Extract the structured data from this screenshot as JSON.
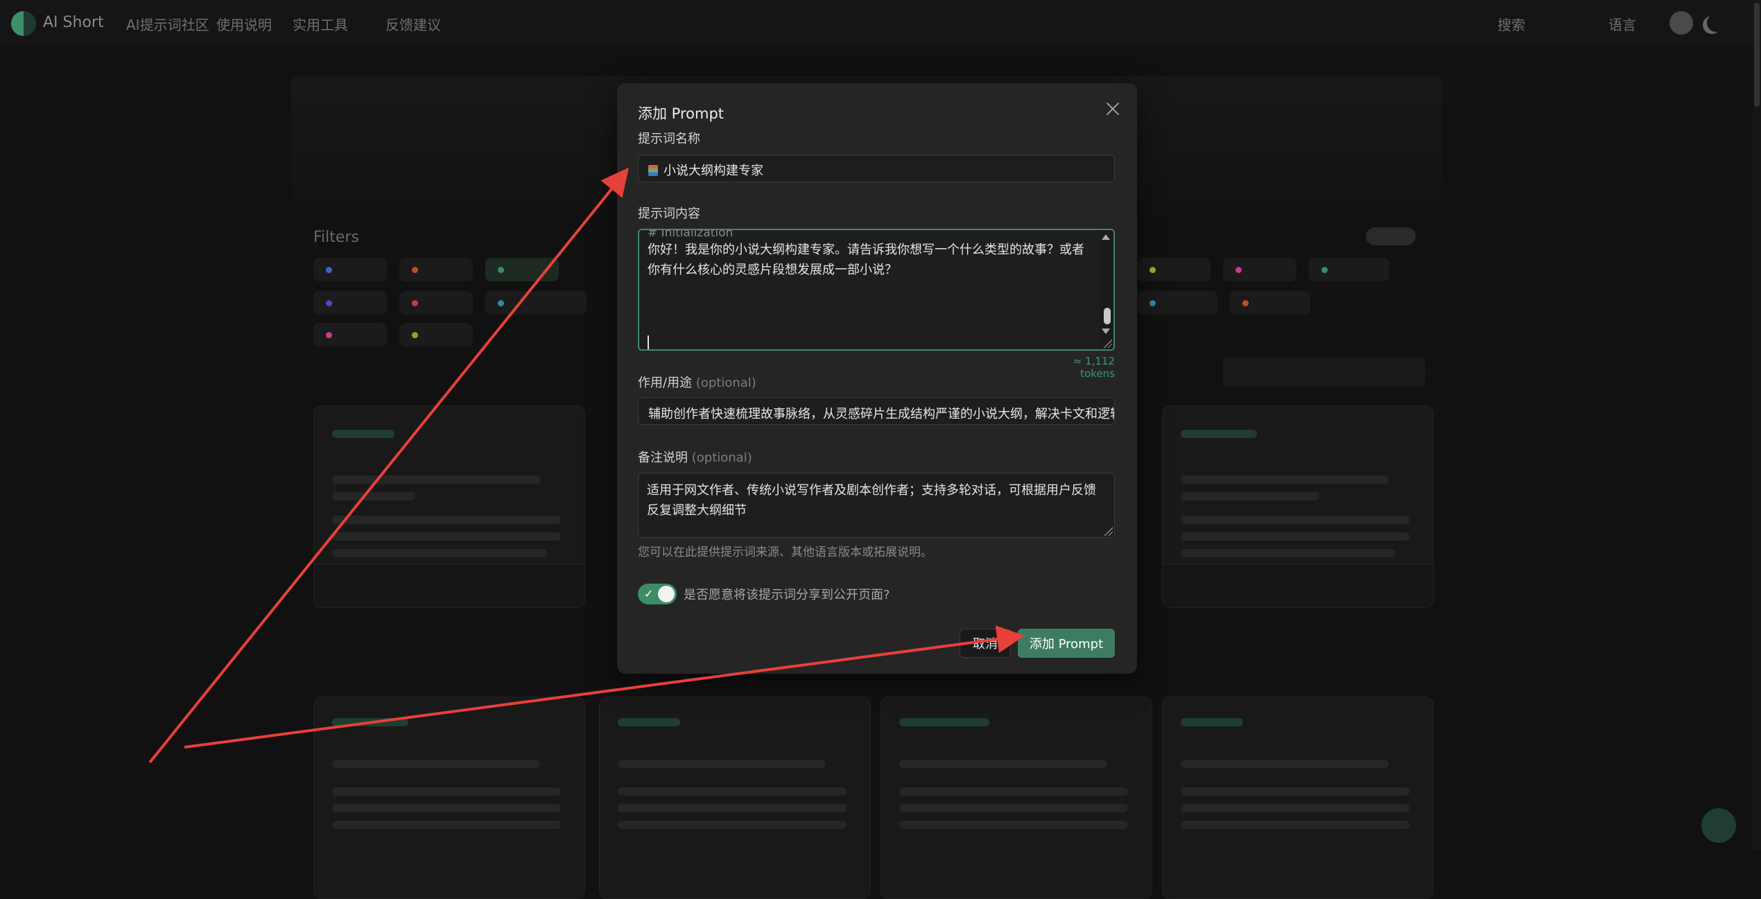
{
  "nav": {
    "brand": "AI Short",
    "links": [
      "AI提示词社区",
      "使用说明",
      "实用工具",
      "反馈建议"
    ],
    "right": [
      "搜索",
      "语言"
    ]
  },
  "background": {
    "filters_title": "Filters"
  },
  "modal": {
    "title": "添加 Prompt",
    "name_label": "提示词名称",
    "name_value": "小说大纲构建专家",
    "content_label": "提示词内容",
    "content_hidden_line": "# Initialization",
    "content_value": "你好！我是你的小说大纲构建专家。请告诉我你想写一个什么类型的故事？或者你有什么核心的灵感片段想发展成一部小说？",
    "tokens": "≈ 1,112 tokens",
    "usage_label": "作用/用途",
    "usage_optional": "(optional)",
    "usage_value": "辅助创作者快速梳理故事脉络，从灵感碎片生成结构严谨的小说大纲，解决卡文和逻辑问题",
    "notes_label": "备注说明",
    "notes_optional": "(optional)",
    "notes_value": "适用于网文作者、传统小说写作者及剧本创作者；支持多轮对话，可根据用户反馈反复调整大纲细节",
    "notes_hint": "您可以在此提供提示词来源、其他语言版本或拓展说明。",
    "share_toggle_on": true,
    "share_label": "是否愿意将该提示词分享到公开页面?",
    "cancel_label": "取消",
    "submit_label": "添加 Prompt"
  },
  "colors": {
    "accent": "#3e8b68",
    "modal_bg": "#252525",
    "arrow": "#e8403a"
  }
}
